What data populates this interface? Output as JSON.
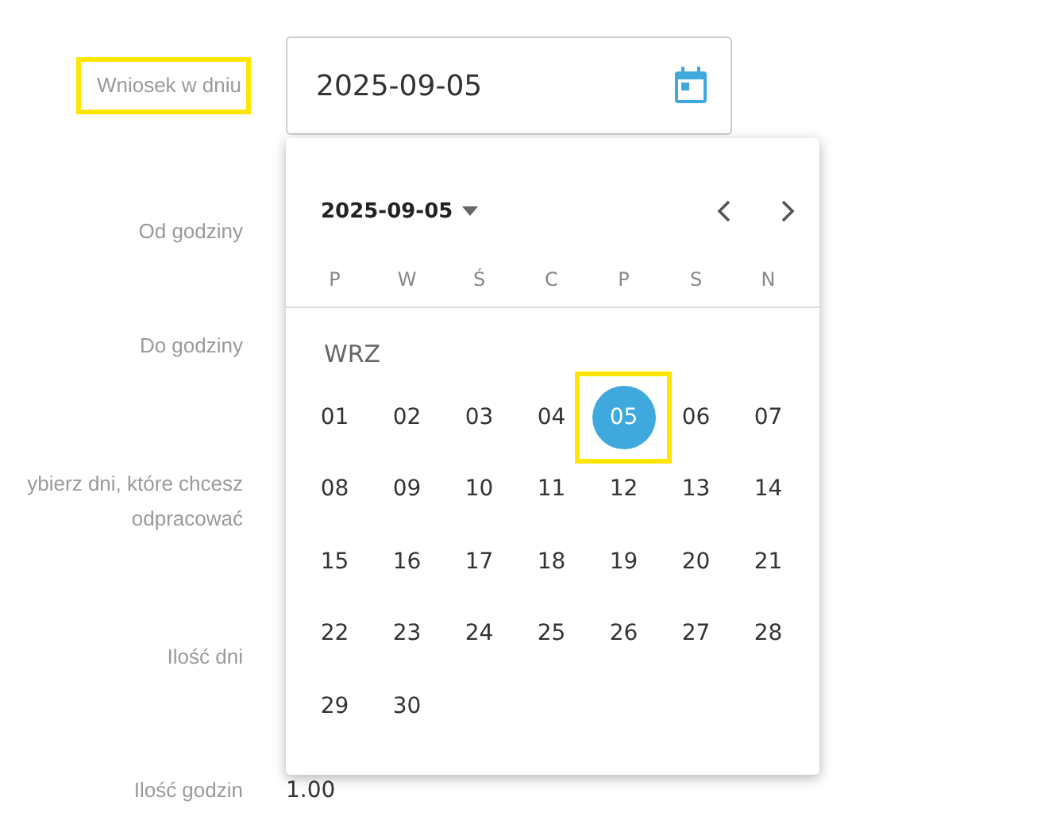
{
  "form": {
    "fields": [
      {
        "label": "Wniosek w dniu",
        "highlighted": true,
        "kind": "date",
        "value": "2025-09-05"
      },
      {
        "label": "Od godziny",
        "highlighted": false,
        "kind": "empty"
      },
      {
        "label": "Do godziny",
        "highlighted": false,
        "kind": "empty"
      },
      {
        "label": "ybierz dni, które chcesz\nodpracować",
        "highlighted": false,
        "kind": "empty"
      },
      {
        "label": "Ilość dni",
        "highlighted": false,
        "kind": "empty"
      },
      {
        "label": "Ilość godzin",
        "highlighted": false,
        "kind": "text",
        "value": "1.00"
      }
    ]
  },
  "datepicker": {
    "header": "2025-09-05",
    "weekdays": [
      "P",
      "W",
      "Ś",
      "C",
      "P",
      "S",
      "N"
    ],
    "month": "WRZ",
    "days": [
      {
        "label": "01",
        "selected": false,
        "highlighted": false
      },
      {
        "label": "02",
        "selected": false,
        "highlighted": false
      },
      {
        "label": "03",
        "selected": false,
        "highlighted": false
      },
      {
        "label": "04",
        "selected": false,
        "highlighted": false
      },
      {
        "label": "05",
        "selected": true,
        "highlighted": true
      },
      {
        "label": "06",
        "selected": false,
        "highlighted": false
      },
      {
        "label": "07",
        "selected": false,
        "highlighted": false
      },
      {
        "label": "08",
        "selected": false,
        "highlighted": false
      },
      {
        "label": "09",
        "selected": false,
        "highlighted": false
      },
      {
        "label": "10",
        "selected": false,
        "highlighted": false
      },
      {
        "label": "11",
        "selected": false,
        "highlighted": false
      },
      {
        "label": "12",
        "selected": false,
        "highlighted": false
      },
      {
        "label": "13",
        "selected": false,
        "highlighted": false
      },
      {
        "label": "14",
        "selected": false,
        "highlighted": false
      },
      {
        "label": "15",
        "selected": false,
        "highlighted": false
      },
      {
        "label": "16",
        "selected": false,
        "highlighted": false
      },
      {
        "label": "17",
        "selected": false,
        "highlighted": false
      },
      {
        "label": "18",
        "selected": false,
        "highlighted": false
      },
      {
        "label": "19",
        "selected": false,
        "highlighted": false
      },
      {
        "label": "20",
        "selected": false,
        "highlighted": false
      },
      {
        "label": "21",
        "selected": false,
        "highlighted": false
      },
      {
        "label": "22",
        "selected": false,
        "highlighted": false
      },
      {
        "label": "23",
        "selected": false,
        "highlighted": false
      },
      {
        "label": "24",
        "selected": false,
        "highlighted": false
      },
      {
        "label": "25",
        "selected": false,
        "highlighted": false
      },
      {
        "label": "26",
        "selected": false,
        "highlighted": false
      },
      {
        "label": "27",
        "selected": false,
        "highlighted": false
      },
      {
        "label": "28",
        "selected": false,
        "highlighted": false
      },
      {
        "label": "29",
        "selected": false,
        "highlighted": false
      },
      {
        "label": "30",
        "selected": false,
        "highlighted": false
      }
    ]
  }
}
